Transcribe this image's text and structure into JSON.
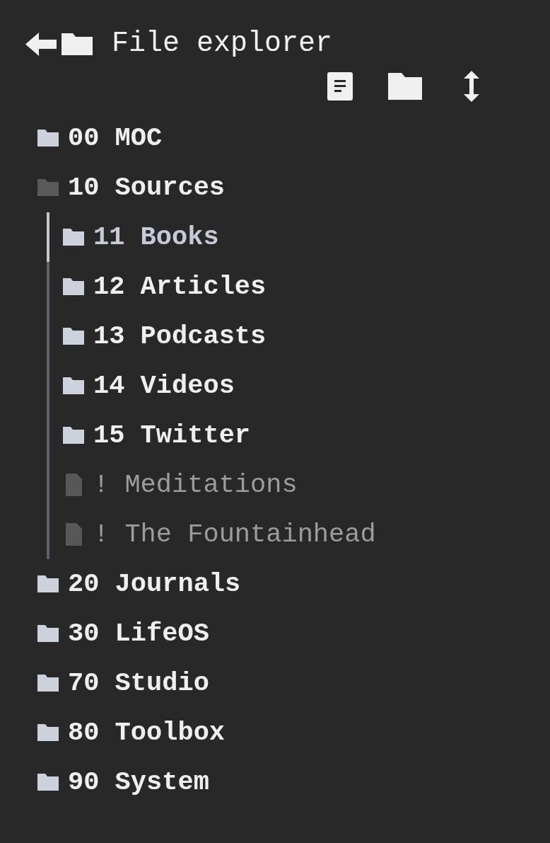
{
  "panel": {
    "title": "File explorer"
  },
  "tree": [
    {
      "label": "00 MOC",
      "kind": "folder",
      "expanded": false,
      "selected": false
    },
    {
      "label": "10 Sources",
      "kind": "folder",
      "expanded": true,
      "selected": false,
      "children": [
        {
          "label": "11 Books",
          "kind": "folder",
          "expanded": false,
          "selected": true
        },
        {
          "label": "12 Articles",
          "kind": "folder",
          "expanded": false,
          "selected": false
        },
        {
          "label": "13 Podcasts",
          "kind": "folder",
          "expanded": false,
          "selected": false
        },
        {
          "label": "14 Videos",
          "kind": "folder",
          "expanded": false,
          "selected": false
        },
        {
          "label": "15 Twitter",
          "kind": "folder",
          "expanded": false,
          "selected": false
        },
        {
          "label": "! Meditations",
          "kind": "file",
          "selected": false
        },
        {
          "label": "! The Fountainhead",
          "kind": "file",
          "selected": false
        }
      ]
    },
    {
      "label": "20 Journals",
      "kind": "folder",
      "expanded": false,
      "selected": false
    },
    {
      "label": "30 LifeOS",
      "kind": "folder",
      "expanded": false,
      "selected": false
    },
    {
      "label": "70 Studio",
      "kind": "folder",
      "expanded": false,
      "selected": false
    },
    {
      "label": "80 Toolbox",
      "kind": "folder",
      "expanded": false,
      "selected": false
    },
    {
      "label": "90 System",
      "kind": "folder",
      "expanded": false,
      "selected": false
    }
  ]
}
